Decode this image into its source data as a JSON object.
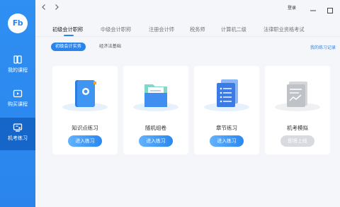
{
  "sidebar": {
    "logo": "Fb",
    "items": [
      {
        "label": "我的课程",
        "icon": "book-icon",
        "active": false
      },
      {
        "label": "购买课程",
        "icon": "video-play-icon",
        "active": false
      },
      {
        "label": "机考练习",
        "icon": "exam-screen-icon",
        "active": true
      }
    ]
  },
  "titlebar": {
    "back_icon": "chevron-left-icon",
    "forward_icon": "chevron-right-icon",
    "login_label": "登录",
    "minimize_icon": "minimize-icon",
    "maximize_icon": "maximize-icon"
  },
  "tabs": [
    {
      "label": "初级会计职称",
      "active": true
    },
    {
      "label": "中级会计职称",
      "active": false
    },
    {
      "label": "注册会计师",
      "active": false
    },
    {
      "label": "税务师",
      "active": false
    },
    {
      "label": "计算机二级",
      "active": false
    },
    {
      "label": "法律职业资格考试",
      "active": false
    }
  ],
  "subtabs": [
    {
      "label": "初级会计实务",
      "active": true
    },
    {
      "label": "经济法基础",
      "active": false
    }
  ],
  "practice_record_link": "我的练习记录",
  "cards": [
    {
      "title": "知识点练习",
      "button": "进入练习",
      "enabled": true,
      "icon": "knowledge-book-icon"
    },
    {
      "title": "随机组卷",
      "button": "进入练习",
      "enabled": true,
      "icon": "folder-icon"
    },
    {
      "title": "章节练习",
      "button": "进入练习",
      "enabled": true,
      "icon": "document-stack-icon"
    },
    {
      "title": "机考模拟",
      "button": "即将上线",
      "enabled": false,
      "icon": "exam-paper-icon"
    }
  ],
  "colors": {
    "accent": "#2a84ec",
    "sidebar_active": "#1666c9",
    "disabled_button": "#d8dadf"
  }
}
